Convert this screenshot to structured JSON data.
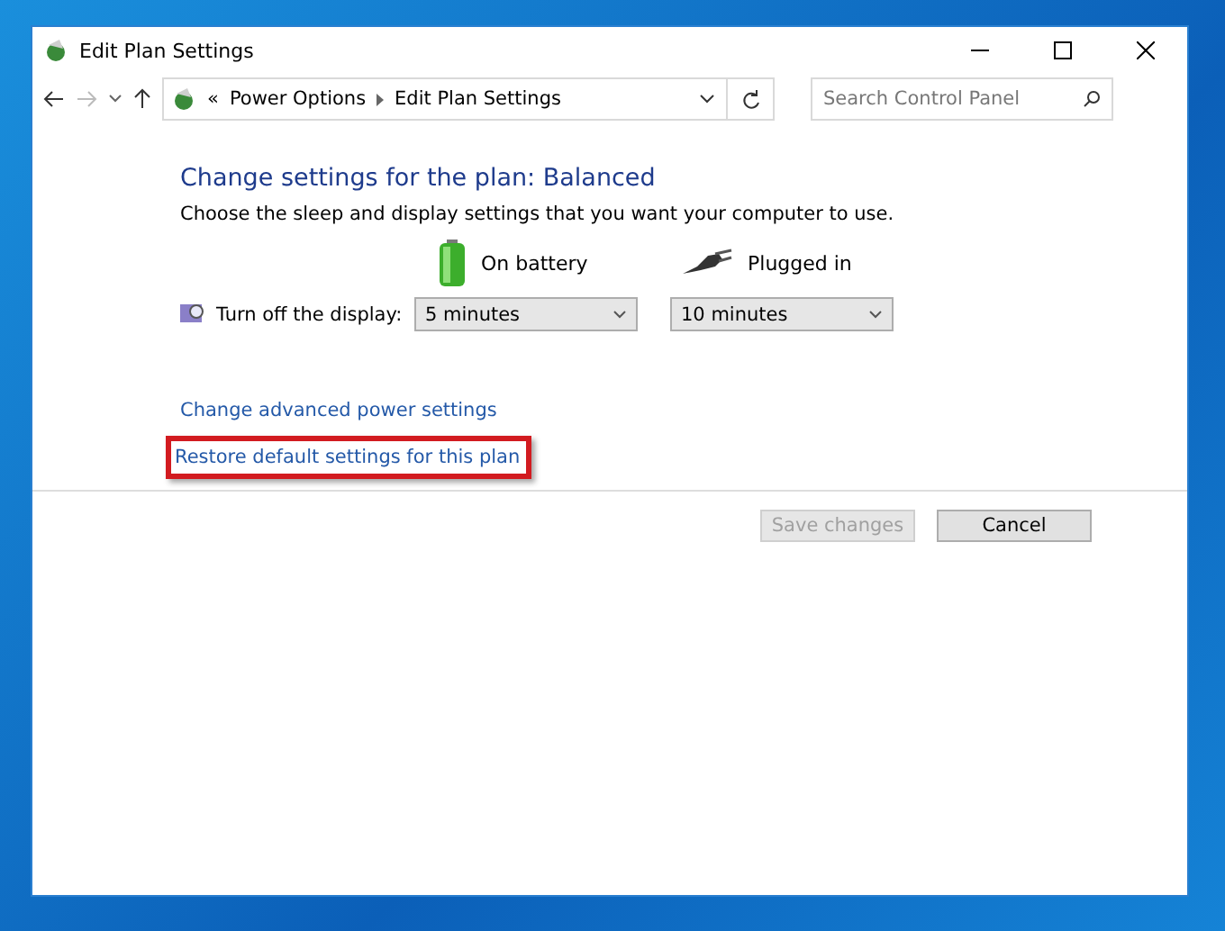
{
  "window": {
    "title": "Edit Plan Settings"
  },
  "address_bar": {
    "breadcrumbs": [
      "«",
      "Power Options",
      "Edit Plan Settings"
    ]
  },
  "search": {
    "placeholder": "Search Control Panel"
  },
  "heading": "Change settings for the plan: Balanced",
  "description": "Choose the sleep and display settings that you want your computer to use.",
  "columns": [
    {
      "kind": "battery",
      "label": "On battery"
    },
    {
      "kind": "plug",
      "label": "Plugged in"
    }
  ],
  "settings": [
    {
      "label": "Turn off the display:",
      "values": [
        "5 minutes",
        "10 minutes"
      ]
    }
  ],
  "links": [
    {
      "label": "Change advanced power settings",
      "highlighted": false
    },
    {
      "label": "Restore default settings for this plan",
      "highlighted": true
    }
  ],
  "buttons": [
    {
      "label": "Save changes",
      "disabled": true
    },
    {
      "label": "Cancel",
      "disabled": false
    }
  ]
}
